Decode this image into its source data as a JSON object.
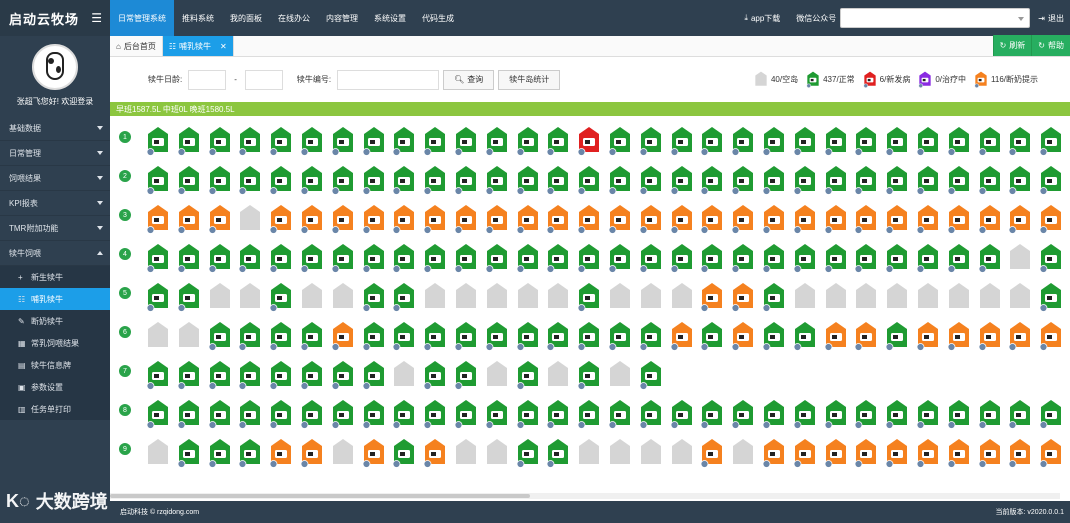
{
  "brand": {
    "name": "启动云牧场",
    "toggle_icon": "menu-icon"
  },
  "profile": {
    "welcome": "张超飞您好! 欢迎登录"
  },
  "sidebar": {
    "items": [
      {
        "label": "基础数据"
      },
      {
        "label": "日常管理"
      },
      {
        "label": "饲喂结果"
      },
      {
        "label": "KPI报表"
      },
      {
        "label": "TMR附加功能"
      },
      {
        "label": "犊牛饲喂"
      }
    ],
    "subitems": [
      {
        "label": "新生犊牛",
        "icon": "+"
      },
      {
        "label": "哺乳犊牛",
        "icon": "☷"
      },
      {
        "label": "断奶犊牛",
        "icon": "✎"
      },
      {
        "label": "常乳饲喂结果",
        "icon": "▦"
      },
      {
        "label": "犊牛信息牌",
        "icon": "▤"
      },
      {
        "label": "参数设置",
        "icon": "▣"
      },
      {
        "label": "任务单打印",
        "icon": "▥"
      }
    ]
  },
  "topnav": [
    "日常管理系统",
    "推料系统",
    "我的面板",
    "在线办公",
    "内容管理",
    "系统设置",
    "代码生成"
  ],
  "topright": {
    "app": "app下载",
    "wechat": "微信公众号",
    "logout": "退出"
  },
  "tabs": {
    "home": "后台首页",
    "current": "哺乳犊牛",
    "refresh": "刷新",
    "help": "帮助"
  },
  "filters": {
    "age_label": "犊牛日龄:",
    "dash": "-",
    "id_label": "犊牛编号:",
    "query": "查询",
    "stats": "犊牛岛统计"
  },
  "legend": [
    {
      "text": "40/空岛",
      "color": "#d5d5d5"
    },
    {
      "text": "437/正常",
      "color": "#1f9b32"
    },
    {
      "text": "6/新发病",
      "color": "#e02020"
    },
    {
      "text": "0/治疗中",
      "color": "#8a2be2"
    },
    {
      "text": "116/断奶提示",
      "color": "#f5811f"
    }
  ],
  "summary": "早班1587.5L 中班0L 晚班1580.5L",
  "colors": {
    "green": "#1f9b32",
    "orange": "#f5811f",
    "red": "#e02020",
    "gray": "#d5d5d5",
    "accent": "#1c9ee8",
    "sidebar": "#2f4050"
  },
  "grid": {
    "row_labels": [
      "1",
      "2",
      "3",
      "4",
      "5",
      "6",
      "7",
      "8",
      "9"
    ],
    "rows": [
      "GGGGGGGGGGGGGGRGGGGGGGGGGGGGGGG",
      "GGGGGGGGGGGGGGGGGGGGGGGGGGGGGGR",
      "OOOEOOOOOOOOOOOOOOOOOOOOOOOOOOG",
      "GGGGGGGGGGGGGGGGGGGGGGGGGGGGEGG",
      "GGEEGEEGGEEEEEGEEEOOGEEEEEEEEGE",
      "EEGGGGOGGGGGGGGGGOGOGGOOGOOOOOG",
      "GGGGGGGGEGGEGEGEG",
      "GGGGGGGGGGGGGGGGGGGGGGGGGGGGGGG",
      "EGGGOOEOGOEEGGEEEEOEOOOOOOOOOOO"
    ]
  },
  "footer": {
    "copy": "启动科技 © rzqidong.com",
    "version": "当前版本: v2020.0.0.1"
  },
  "watermark": "大数跨境"
}
